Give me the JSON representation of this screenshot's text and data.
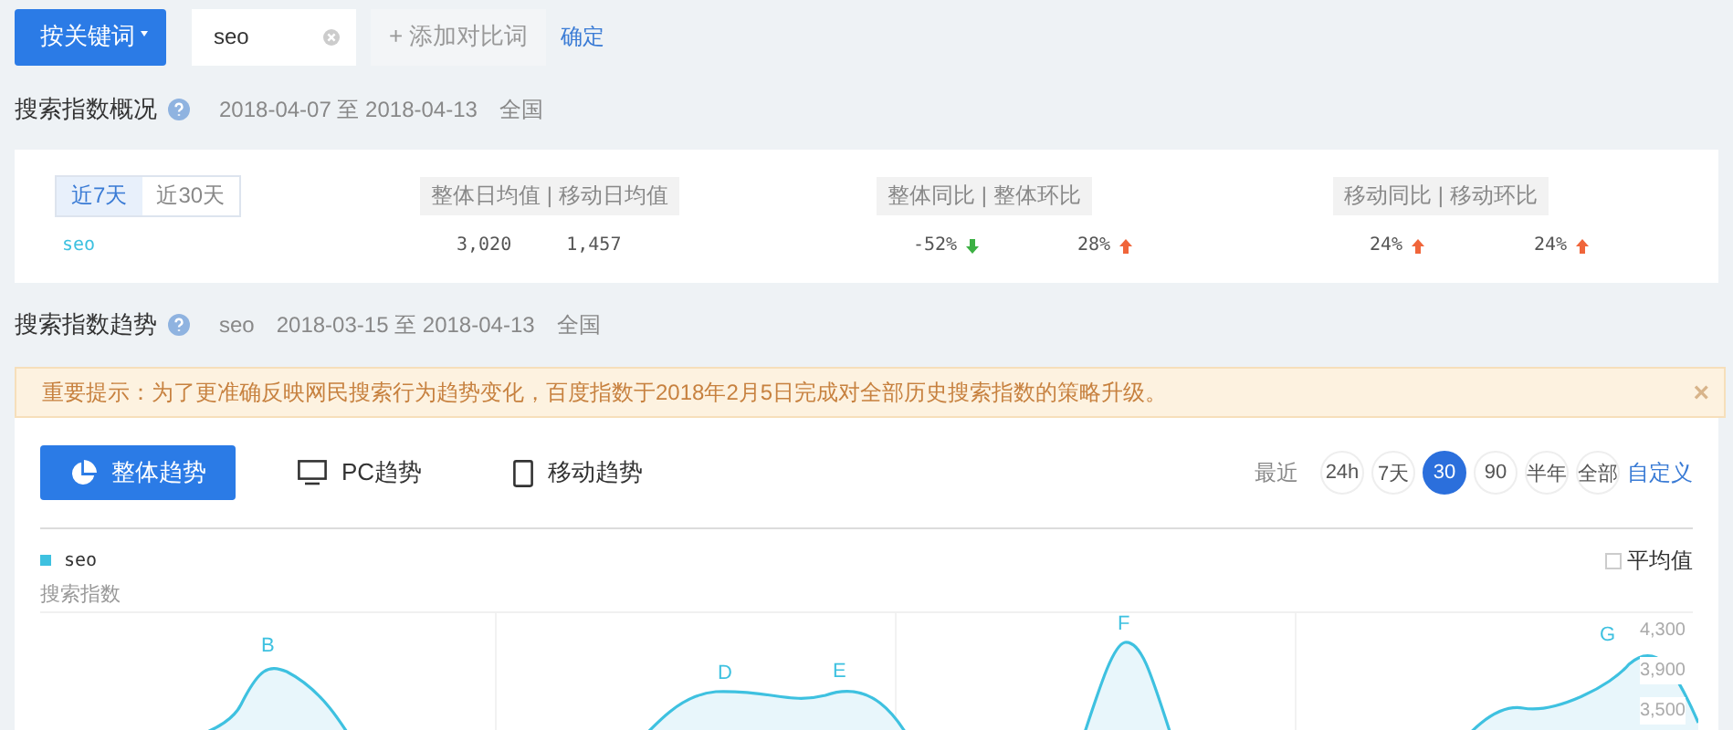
{
  "top_bar": {
    "mode_button": "按关键词",
    "keyword_field": {
      "value": "seo"
    },
    "add_button": "+ 添加对比词",
    "confirm_link": "确定"
  },
  "overview": {
    "title": "搜索指数概况",
    "date_range": "2018-04-07 至 2018-04-13",
    "region": "全国",
    "tabs": [
      {
        "label": "近7天",
        "selected": true
      },
      {
        "label": "近30天",
        "selected": false
      }
    ],
    "column_groups": [
      {
        "label": "整体日均值 | 移动日均值"
      },
      {
        "label": "整体同比 | 整体环比"
      },
      {
        "label": "移动同比 | 移动环比"
      }
    ],
    "rows": [
      {
        "keyword": "seo",
        "daily_total": "3,020",
        "daily_mobile": "1,457",
        "changes": [
          {
            "value": "-52%",
            "kind": "falling"
          },
          {
            "value": "28%",
            "kind": "rising"
          },
          {
            "value": "24%",
            "kind": "rising"
          },
          {
            "value": "24%",
            "kind": "rising"
          }
        ]
      }
    ]
  },
  "trend": {
    "title": "搜索指数趋势",
    "keyword": "seo",
    "date_range": "2018-03-15 至 2018-04-13",
    "region": "全国",
    "notice": {
      "text": "重要提示：为了更准确反映网民搜索行为趋势变化，百度指数于2018年2月5日完成对全部历史搜索指数的策略升级。",
      "close": "×"
    },
    "views": [
      {
        "label": "整体趋势",
        "kind": "overall",
        "selected": true
      },
      {
        "label": "PC趋势",
        "kind": "pc",
        "selected": false
      },
      {
        "label": "移动趋势",
        "kind": "mobile",
        "selected": false
      }
    ],
    "range_label": "最近",
    "ranges": [
      {
        "label": "24h",
        "selected": false
      },
      {
        "label": "7天",
        "selected": false
      },
      {
        "label": "30",
        "selected": true
      },
      {
        "label": "90",
        "selected": false
      },
      {
        "label": "半年",
        "selected": false
      },
      {
        "label": "全部",
        "selected": false
      }
    ],
    "custom_link": "自定义",
    "legend": [
      {
        "name": "seo",
        "color": "#3ec1e0"
      }
    ],
    "average_toggle": {
      "label": "平均值",
      "checked": false
    },
    "y_axis_title": "搜索指数",
    "y_ticks": [
      "4,300",
      "3,900",
      "3,500"
    ],
    "point_labels": [
      "B",
      "D",
      "E",
      "F",
      "G"
    ]
  }
}
